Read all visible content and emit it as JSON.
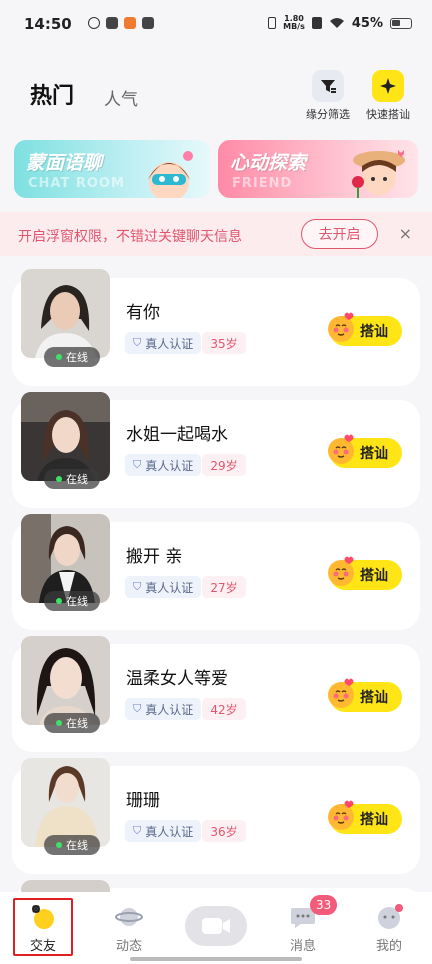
{
  "status_bar": {
    "time": "14:50",
    "speed_value": "1.80",
    "speed_unit": "MB/s",
    "battery": "45%"
  },
  "tabs": [
    {
      "label": "热门",
      "active": true
    },
    {
      "label": "人气",
      "active": false
    }
  ],
  "tools": [
    {
      "label": "缘分筛选",
      "icon": "filter-icon"
    },
    {
      "label": "快速搭讪",
      "icon": "sparkle-icon"
    }
  ],
  "banners": [
    {
      "title": "蒙面语聊",
      "subtitle": "CHAT ROOM",
      "color": "#7ee0e0"
    },
    {
      "title": "心动探索",
      "subtitle": "FRIEND",
      "color": "#ff8aa6"
    }
  ],
  "notice": {
    "text": "开启浮窗权限，不错过关键聊天信息",
    "button": "去开启",
    "close": "×"
  },
  "users": [
    {
      "name": "有你",
      "verified": "真人认证",
      "age": "35岁",
      "status": "在线",
      "cta": "搭讪"
    },
    {
      "name": "水姐一起喝水",
      "verified": "真人认证",
      "age": "29岁",
      "status": "在线",
      "cta": "搭讪"
    },
    {
      "name": "搬开 亲",
      "verified": "真人认证",
      "age": "27岁",
      "status": "在线",
      "cta": "搭讪"
    },
    {
      "name": "温柔女人等爱",
      "verified": "真人认证",
      "age": "42岁",
      "status": "在线",
      "cta": "搭讪"
    },
    {
      "name": "珊珊",
      "verified": "真人认证",
      "age": "36岁",
      "status": "在线",
      "cta": "搭讪"
    }
  ],
  "bottom_nav": {
    "items": [
      {
        "label": "交友",
        "active": true
      },
      {
        "label": "动态",
        "active": false
      },
      {
        "label": "消息",
        "active": false
      },
      {
        "label": "我的",
        "active": false
      }
    ],
    "message_badge": "33"
  },
  "colors": {
    "accent_yellow": "#ffe515",
    "accent_pink": "#e0566e",
    "online_green": "#3ee06a"
  }
}
